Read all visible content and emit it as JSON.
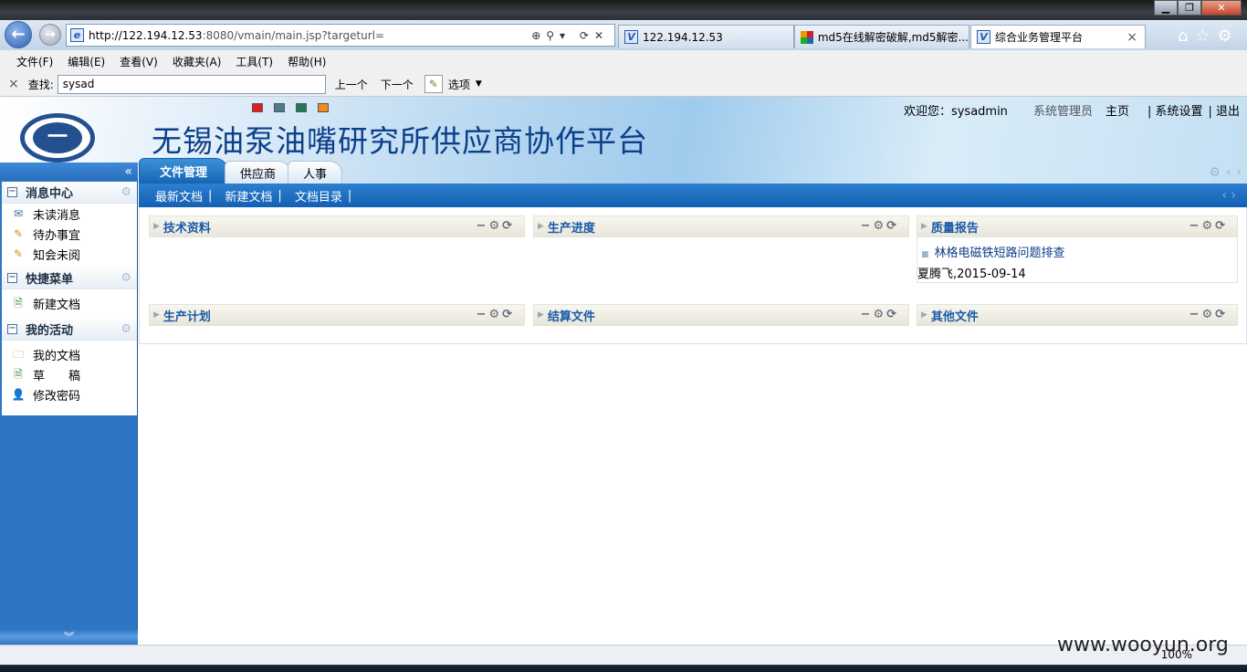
{
  "window": {
    "minimize": "▁",
    "restore": "❐",
    "close": "✕"
  },
  "browser": {
    "back": "←",
    "forward": "→",
    "address_host": "http://122.194.12.53",
    "address_rest": ":8080/vmain/main.jsp?targeturl=",
    "tabs": [
      {
        "label": "122.194.12.53"
      },
      {
        "label": "md5在线解密破解,md5解密..."
      },
      {
        "label": "综合业务管理平台"
      }
    ],
    "tab_close": "×",
    "menu": [
      "文件(F)",
      "编辑(E)",
      "查看(V)",
      "收藏夹(A)",
      "工具(T)",
      "帮助(H)"
    ],
    "find": {
      "close": "×",
      "label": "查找:",
      "value": "sysad",
      "prev": "上一个",
      "next": "下一个",
      "options": "选项"
    },
    "zoom": "100%"
  },
  "header": {
    "title": "无锡油泵油嘴研究所供应商协作平台",
    "swatch_colors": [
      "#e01e1e",
      "#4d7a8c",
      "#1f7a5a",
      "#f08a1a"
    ],
    "welcome_label": "欢迎您：sysadmin",
    "role": "系统管理员",
    "home": "主页",
    "settings": "| 系统设置",
    "logout": "| 退出"
  },
  "module_tabs": [
    "文件管理",
    "供应商",
    "人事"
  ],
  "subnav": [
    "最新文档",
    "新建文档",
    "文档目录"
  ],
  "sidebar": {
    "collapse": "«",
    "sections": [
      {
        "title": "消息中心",
        "items": [
          "未读消息",
          "待办事宜",
          "知会未阅"
        ]
      },
      {
        "title": "快捷菜单",
        "items": [
          "新建文档"
        ]
      },
      {
        "title": "我的活动",
        "items": [
          "我的文档",
          "草　　稿",
          "修改密码"
        ]
      }
    ],
    "expand": "︾"
  },
  "portlets": [
    {
      "title": "技术资料"
    },
    {
      "title": "生产进度"
    },
    {
      "title": "质量报告",
      "item": "林格电磁铁短路问题排查",
      "meta": "夏腾飞,2015-09-14"
    },
    {
      "title": "生产计划"
    },
    {
      "title": "结算文件"
    },
    {
      "title": "其他文件"
    }
  ],
  "watermark": "www.wooyun.org"
}
